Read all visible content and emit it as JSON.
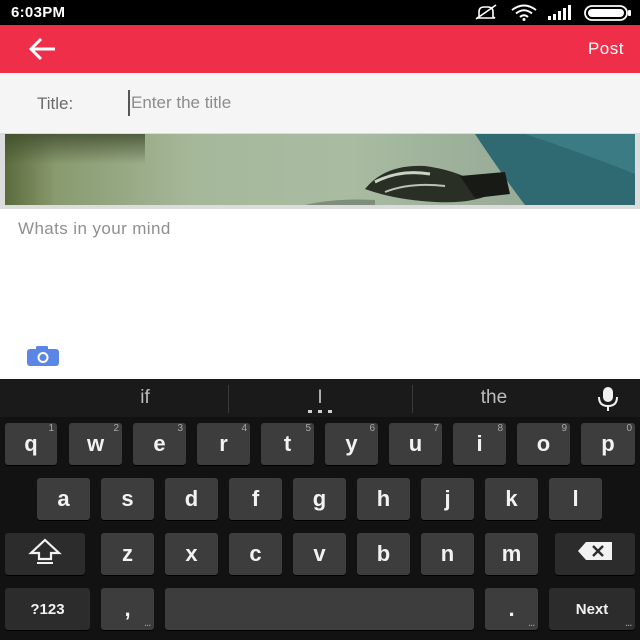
{
  "status_bar": {
    "time": "6:03PM"
  },
  "app_bar": {
    "post_label": "Post",
    "color": "#ef2f4a"
  },
  "title_row": {
    "label": "Title:",
    "placeholder": "Enter the title",
    "value": ""
  },
  "message": {
    "placeholder": "Whats in your mind",
    "value": ""
  },
  "keyboard": {
    "suggestions": [
      "if",
      "I",
      "the"
    ],
    "row1": [
      {
        "label": "q",
        "hint": "1"
      },
      {
        "label": "w",
        "hint": "2"
      },
      {
        "label": "e",
        "hint": "3"
      },
      {
        "label": "r",
        "hint": "4"
      },
      {
        "label": "t",
        "hint": "5"
      },
      {
        "label": "y",
        "hint": "6"
      },
      {
        "label": "u",
        "hint": "7"
      },
      {
        "label": "i",
        "hint": "8"
      },
      {
        "label": "o",
        "hint": "9"
      },
      {
        "label": "p",
        "hint": "0"
      }
    ],
    "row2": [
      "a",
      "s",
      "d",
      "f",
      "g",
      "h",
      "j",
      "k",
      "l"
    ],
    "row3": [
      "z",
      "x",
      "c",
      "v",
      "b",
      "n",
      "m"
    ],
    "symbols_label": "?123",
    "comma_label": ",",
    "period_label": ".",
    "action_label": "Next"
  }
}
